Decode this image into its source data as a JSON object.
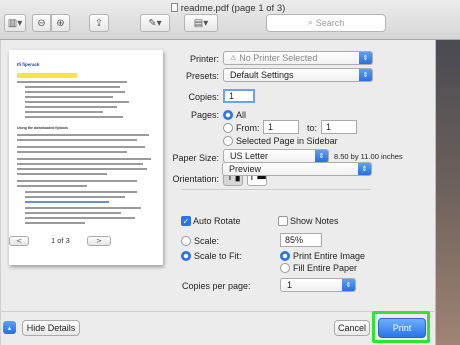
{
  "window": {
    "title": "readme.pdf (page 1 of 3)",
    "search_placeholder": "Search"
  },
  "preview": {
    "page_heading": "Ifi fiperack",
    "page_highlight": "The contents of the package",
    "page_subheading": "Using the downloaded fiptools",
    "page_counter": "1 of 3",
    "prev_label": "<",
    "next_label": ">"
  },
  "print": {
    "printer_label": "Printer:",
    "printer_value": "No Printer Selected",
    "presets_label": "Presets:",
    "presets_value": "Default Settings",
    "copies_label": "Copies:",
    "copies_value": "1",
    "pages_label": "Pages:",
    "pages_all": "All",
    "pages_from_label": "From:",
    "pages_from_value": "1",
    "pages_to_label": "to:",
    "pages_to_value": "1",
    "pages_selected": "Selected Page in Sidebar",
    "paper_label": "Paper Size:",
    "paper_value": "US Letter",
    "paper_dimensions": "8.50 by 11.00 inches",
    "orientation_label": "Orientation:",
    "section_value": "Preview",
    "auto_rotate_label": "Auto Rotate",
    "show_notes_label": "Show Notes",
    "scale_label": "Scale:",
    "scale_value": "85%",
    "scale_to_fit_label": "Scale to Fit:",
    "print_entire_label": "Print Entire Image",
    "fill_paper_label": "Fill Entire Paper",
    "copies_per_page_label": "Copies per page:",
    "copies_per_page_value": "1"
  },
  "footer": {
    "hide_details": "Hide Details",
    "cancel": "Cancel",
    "print": "Print"
  },
  "colors": {
    "accent": "#2a74e8",
    "highlight_box": "#2ee62e"
  }
}
